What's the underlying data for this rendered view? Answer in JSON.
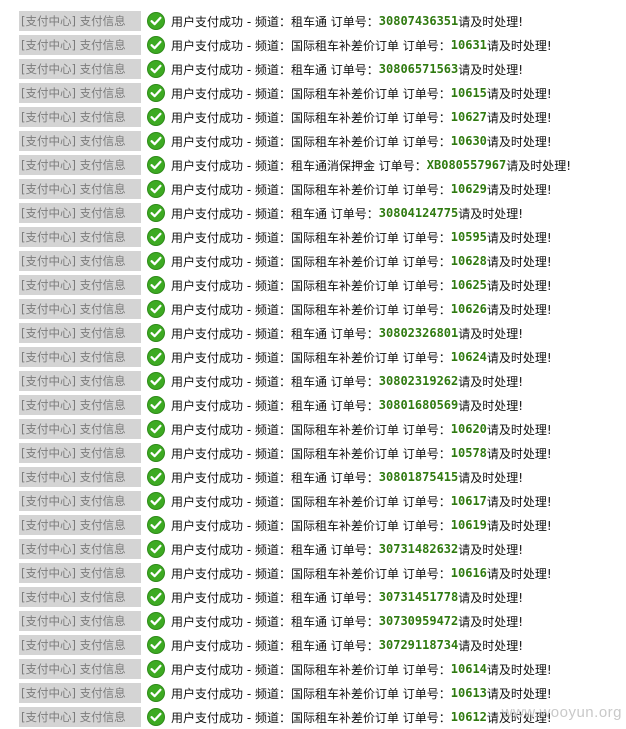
{
  "tag_label": "[支付中心] 支付信息",
  "watermark": "www.wooyun.org",
  "rows": [
    {
      "message": "用户支付成功 - 频道：租车通 订单号：",
      "order_id": "30807436351",
      "suffix": "请及时处理!"
    },
    {
      "message": "用户支付成功 - 频道：国际租车补差价订单 订单号：",
      "order_id": "10631",
      "suffix": "请及时处理!"
    },
    {
      "message": "用户支付成功 - 频道：租车通 订单号：",
      "order_id": "30806571563",
      "suffix": "请及时处理!"
    },
    {
      "message": "用户支付成功 - 频道：国际租车补差价订单 订单号：",
      "order_id": "10615",
      "suffix": "请及时处理!"
    },
    {
      "message": "用户支付成功 - 频道：国际租车补差价订单 订单号：",
      "order_id": "10627",
      "suffix": "请及时处理!"
    },
    {
      "message": "用户支付成功 - 频道：国际租车补差价订单 订单号：",
      "order_id": "10630",
      "suffix": "请及时处理!"
    },
    {
      "message": "用户支付成功 - 频道：租车通消保押金 订单号：",
      "order_id": "XB080557967",
      "suffix": "请及时处理!"
    },
    {
      "message": "用户支付成功 - 频道：国际租车补差价订单 订单号：",
      "order_id": "10629",
      "suffix": "请及时处理!"
    },
    {
      "message": "用户支付成功 - 频道：租车通 订单号：",
      "order_id": "30804124775",
      "suffix": "请及时处理!"
    },
    {
      "message": "用户支付成功 - 频道：国际租车补差价订单 订单号：",
      "order_id": "10595",
      "suffix": "请及时处理!"
    },
    {
      "message": "用户支付成功 - 频道：国际租车补差价订单 订单号：",
      "order_id": "10628",
      "suffix": "请及时处理!"
    },
    {
      "message": "用户支付成功 - 频道：国际租车补差价订单 订单号：",
      "order_id": "10625",
      "suffix": "请及时处理!"
    },
    {
      "message": "用户支付成功 - 频道：国际租车补差价订单 订单号：",
      "order_id": "10626",
      "suffix": "请及时处理!"
    },
    {
      "message": "用户支付成功 - 频道：租车通 订单号：",
      "order_id": "30802326801",
      "suffix": "请及时处理!"
    },
    {
      "message": "用户支付成功 - 频道：国际租车补差价订单 订单号：",
      "order_id": "10624",
      "suffix": "请及时处理!"
    },
    {
      "message": "用户支付成功 - 频道：租车通 订单号：",
      "order_id": "30802319262",
      "suffix": "请及时处理!"
    },
    {
      "message": "用户支付成功 - 频道：租车通 订单号：",
      "order_id": "30801680569",
      "suffix": "请及时处理!"
    },
    {
      "message": "用户支付成功 - 频道：国际租车补差价订单 订单号：",
      "order_id": "10620",
      "suffix": "请及时处理!"
    },
    {
      "message": "用户支付成功 - 频道：国际租车补差价订单 订单号：",
      "order_id": "10578",
      "suffix": "请及时处理!"
    },
    {
      "message": "用户支付成功 - 频道：租车通 订单号：",
      "order_id": "30801875415",
      "suffix": "请及时处理!"
    },
    {
      "message": "用户支付成功 - 频道：国际租车补差价订单 订单号：",
      "order_id": "10617",
      "suffix": "请及时处理!"
    },
    {
      "message": "用户支付成功 - 频道：国际租车补差价订单 订单号：",
      "order_id": "10619",
      "suffix": "请及时处理!"
    },
    {
      "message": "用户支付成功 - 频道：租车通 订单号：",
      "order_id": "30731482632",
      "suffix": "请及时处理!"
    },
    {
      "message": "用户支付成功 - 频道：国际租车补差价订单 订单号：",
      "order_id": "10616",
      "suffix": "请及时处理!"
    },
    {
      "message": "用户支付成功 - 频道：租车通 订单号：",
      "order_id": "30731451778",
      "suffix": "请及时处理!"
    },
    {
      "message": "用户支付成功 - 频道：租车通 订单号：",
      "order_id": "30730959472",
      "suffix": "请及时处理!"
    },
    {
      "message": "用户支付成功 - 频道：租车通 订单号：",
      "order_id": "30729118734",
      "suffix": "请及时处理!"
    },
    {
      "message": "用户支付成功 - 频道：国际租车补差价订单 订单号：",
      "order_id": "10614",
      "suffix": "请及时处理!"
    },
    {
      "message": "用户支付成功 - 频道：国际租车补差价订单 订单号：",
      "order_id": "10613",
      "suffix": "请及时处理!"
    },
    {
      "message": "用户支付成功 - 频道：国际租车补差价订单 订单号：",
      "order_id": "10612",
      "suffix": "请及时处理!"
    }
  ]
}
